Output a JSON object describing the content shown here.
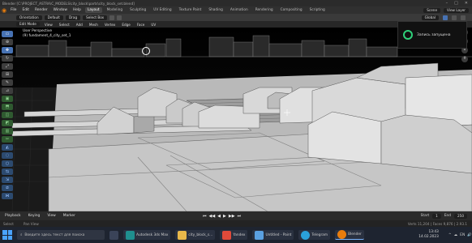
{
  "window": {
    "title": "Blender [C:\\PROJECT_ASTRA\\C_MODELS\\city_block\\parts\\city_block_set.blend]",
    "controls": [
      "–",
      "□",
      "✕"
    ]
  },
  "menubar": {
    "items": [
      "File",
      "Edit",
      "Render",
      "Window",
      "Help"
    ],
    "tabs": [
      "Layout",
      "Modeling",
      "Sculpting",
      "UV Editing",
      "Texture Paint",
      "Shading",
      "Animation",
      "Rendering",
      "Compositing",
      "Scripting"
    ],
    "active_tab": "Layout",
    "left_fields": [
      "Orientation",
      "Default",
      "Drag",
      "Select Box"
    ],
    "scene": "Scene",
    "view_layer": "View Layer"
  },
  "tool_header": {
    "mode": "Edit Mode",
    "items": [
      "View",
      "Select",
      "Add",
      "Mesh",
      "Vertex",
      "Edge",
      "Face",
      "UV"
    ],
    "transform": "Global"
  },
  "viewport_overlay": {
    "line1": "User Perspective",
    "line2": "(9) fundament_4_city_set_1"
  },
  "notification": {
    "text": "Запись запущена",
    "ring_color": "#2fd17a"
  },
  "toolbar": {
    "tools": [
      "select-box",
      "cursor",
      "move",
      "rotate",
      "scale",
      "transform",
      "annotate",
      "measure",
      "add-cube",
      "extrude",
      "inset",
      "bevel",
      "loop-cut",
      "knife",
      "poly-build",
      "spin",
      "smooth",
      "edge-slide",
      "shrink",
      "shear",
      "rip"
    ]
  },
  "timeline": {
    "items": [
      "Playback",
      "Keying",
      "View",
      "Marker"
    ],
    "transport": [
      "⏮",
      "◀◀",
      "◀",
      "▶",
      "▶▶",
      "⏭"
    ],
    "frame_labels": [
      "Start",
      "1",
      "End",
      "250"
    ]
  },
  "statusbar": {
    "left": "Select",
    "middle": "Pan View",
    "right": "Verts 11,204 | Faces 9,876 | 2.93.1"
  },
  "taskbar": {
    "search_placeholder": "Введите здесь текст для поиска",
    "apps": [
      "Autodesk 3ds Max",
      "city_block_s...",
      "Yandex",
      "Untitled - Paint",
      "Telegram",
      "Blender"
    ],
    "tray": [
      "^",
      "☁",
      "EN",
      "🔊"
    ],
    "time": "13:43",
    "date": "14.02.2023"
  }
}
